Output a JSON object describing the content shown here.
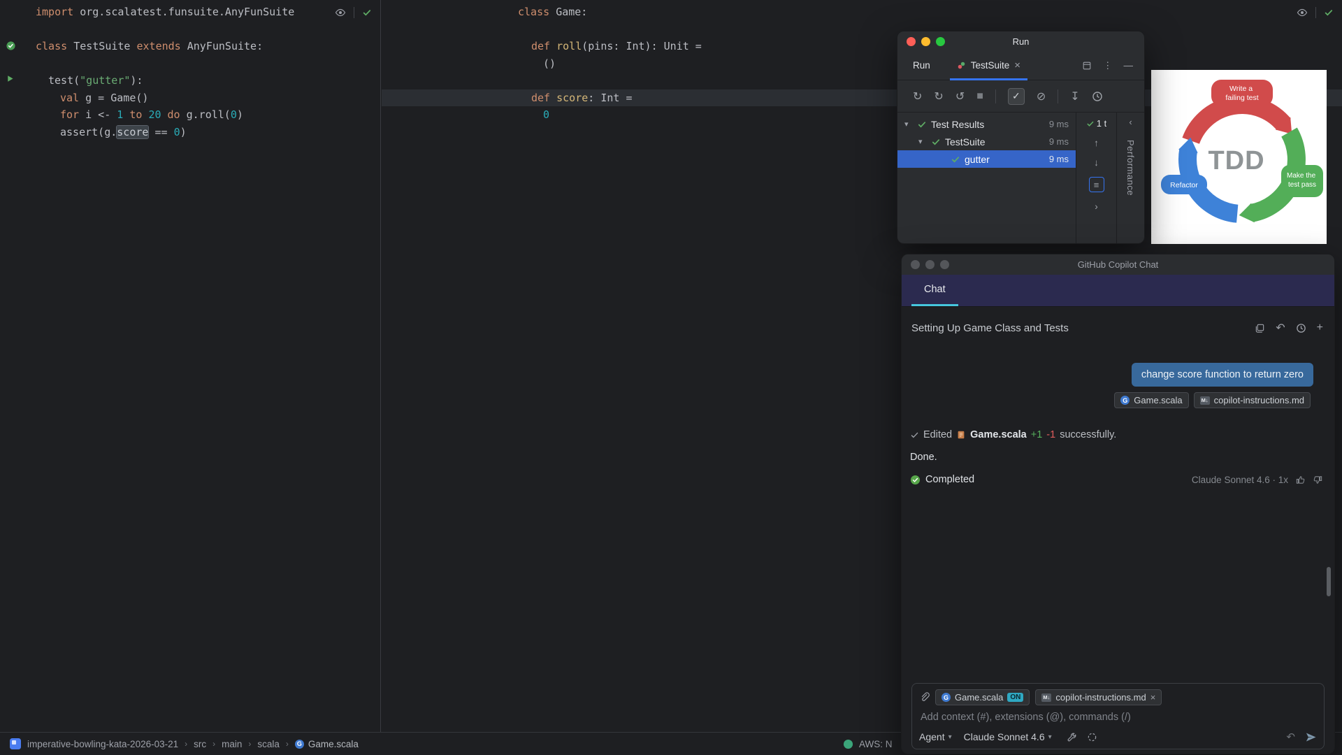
{
  "icons": {
    "chevron": "▾",
    "more": "⋮",
    "hide": "—",
    "close": "×",
    "rerun": "↻",
    "rerunauto": "↺",
    "stop": "■",
    "check": "✓",
    "ignore": "⊘",
    "collapseall": "↧",
    "next": "›",
    "prev": "‹",
    "up": "↑",
    "down": "↓",
    "undo": "↶",
    "plus": "+",
    "sep": "›",
    "sort": "≡",
    "caret": "▾"
  },
  "colors": {
    "keyword": "#cf8e6d",
    "plain": "#bcbec4",
    "string": "#6aab73",
    "number": "#2aacb8",
    "method": "#d5b778",
    "accent_blue": "#3574f0",
    "accent_cyan": "#46c6de",
    "selection": "#3665c8",
    "pass_green": "#5fad65",
    "diff_add": "#57b05c",
    "diff_del": "#e05c5c"
  },
  "editor_left": {
    "lines": [
      {
        "indent": 0,
        "tokens": [
          [
            "import ",
            "kw"
          ],
          [
            "org.scalatest.funsuite.AnyFunSuite",
            "pl"
          ]
        ]
      },
      {
        "blank": true
      },
      {
        "indent": 0,
        "tokens": [
          [
            "class ",
            "kw"
          ],
          [
            "TestSuite ",
            "pl"
          ],
          [
            "extends ",
            "kw"
          ],
          [
            "AnyFunSuite:",
            "pl"
          ]
        ]
      },
      {
        "blank": true
      },
      {
        "indent": 1,
        "tokens": [
          [
            "test(",
            "pl"
          ],
          [
            "\"gutter\"",
            "str"
          ],
          [
            "):",
            "pl"
          ]
        ]
      },
      {
        "indent": 2,
        "tokens": [
          [
            "val ",
            "kw"
          ],
          [
            "g = Game()",
            "pl"
          ]
        ]
      },
      {
        "indent": 2,
        "tokens": [
          [
            "for ",
            "kw"
          ],
          [
            "i <- ",
            "pl"
          ],
          [
            "1",
            "num"
          ],
          [
            " ",
            "pl"
          ],
          [
            "to",
            "kw"
          ],
          [
            " ",
            "pl"
          ],
          [
            "20",
            "num"
          ],
          [
            " ",
            "pl"
          ],
          [
            "do",
            "kw"
          ],
          [
            " g.roll(",
            "pl"
          ],
          [
            "0",
            "num"
          ],
          [
            ")",
            "pl"
          ]
        ]
      },
      {
        "indent": 2,
        "tokens": [
          [
            "assert(g.",
            "pl"
          ],
          [
            "score",
            "hl"
          ],
          [
            " == ",
            "pl"
          ],
          [
            "0",
            "num"
          ],
          [
            ")",
            "pl"
          ]
        ]
      }
    ]
  },
  "editor_mid": {
    "lines": [
      {
        "indent": 0,
        "tokens": [
          [
            "class ",
            "kw"
          ],
          [
            "Game:",
            "pl"
          ]
        ]
      },
      {
        "blank": true
      },
      {
        "indent": 1,
        "tokens": [
          [
            "def ",
            "kw"
          ],
          [
            "roll",
            "fn"
          ],
          [
            "(pins: Int): Unit =",
            "pl"
          ]
        ]
      },
      {
        "indent": 2,
        "tokens": [
          [
            "()",
            "pl"
          ]
        ]
      },
      {
        "blank": true
      },
      {
        "indent": 1,
        "highlight": true,
        "tokens": [
          [
            "def ",
            "kw"
          ],
          [
            "score",
            "fn"
          ],
          [
            ": Int =",
            "pl"
          ]
        ]
      },
      {
        "indent": 2,
        "tokens": [
          [
            "0",
            "num"
          ]
        ]
      }
    ]
  },
  "run_window": {
    "window_title": "Run",
    "tool_label": "Run",
    "tab_label": "TestSuite",
    "tests": [
      {
        "label": "Test Results",
        "time": "9 ms",
        "level": 0,
        "expanded": true
      },
      {
        "label": "TestSuite",
        "time": "9 ms",
        "level": 1,
        "expanded": true
      },
      {
        "label": "gutter",
        "time": "9 ms",
        "level": 2,
        "selected": true
      }
    ],
    "passed_badge": "1 t",
    "side_tab": "Performance"
  },
  "tdd": {
    "center": "TDD",
    "label_top": [
      "Write a",
      "failing test"
    ],
    "label_right": [
      "Make the",
      "test pass"
    ],
    "label_left": [
      "Refactor"
    ]
  },
  "copilot": {
    "title": "GitHub Copilot Chat",
    "tab": "Chat",
    "thread_title": "Setting Up Game Class and Tests",
    "user_message": "change score function to return zero",
    "message_chips": [
      {
        "label": "Game.scala",
        "icon": "class"
      },
      {
        "label": "copilot-instructions.md",
        "icon": "md"
      }
    ],
    "edited": {
      "prefix": "Edited",
      "file": "Game.scala",
      "added": "+1",
      "removed": "-1",
      "suffix": "successfully."
    },
    "done": "Done.",
    "completed": "Completed",
    "model_info": "Claude Sonnet 4.6 · 1x",
    "input_chips": [
      {
        "label": "Game.scala",
        "icon": "class",
        "badge": "ON"
      },
      {
        "label": "copilot-instructions.md",
        "icon": "md",
        "close": true
      }
    ],
    "input_placeholder": "Add context (#), extensions (@), commands (/)",
    "agent_label": "Agent",
    "model_label": "Claude Sonnet 4.6"
  },
  "status_bar": {
    "breadcrumbs": [
      "imperative-bowling-kata-2026-03-21",
      "src",
      "main",
      "scala",
      "Game.scala"
    ],
    "aws_text": "AWS: N"
  }
}
